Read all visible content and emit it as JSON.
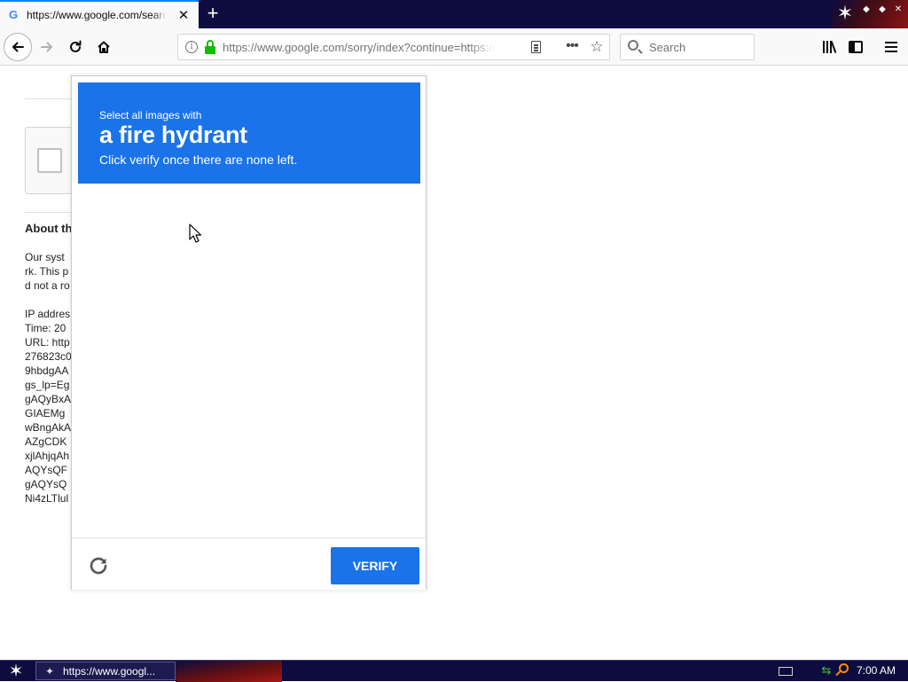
{
  "browser": {
    "tab": {
      "title": "https://www.google.com/search?q",
      "favicon": "G"
    },
    "nav": {
      "back_icon": "back-arrow-icon",
      "forward_icon": "forward-arrow-icon",
      "reload_icon": "reload-icon",
      "home_icon": "home-icon"
    },
    "urlbar": {
      "url": "https://www.google.com/sorry/index?continue=https://www"
    },
    "search": {
      "placeholder": "Search"
    }
  },
  "page": {
    "about_heading": "About th",
    "lines_group1": [
      "Our syst",
      "rk. This p",
      "d not a ro"
    ],
    "lines_group2": [
      "IP addres",
      "Time: 20",
      "URL: http",
      "276823c0",
      "9hbdgAA",
      "gs_lp=Eg",
      "gAQyBxA",
      "GIAEMg",
      "wBngAkA",
      "AZgCDK",
      "xjlAhjqAh",
      "AQYsQF",
      "gAQYsQ",
      "Ni4zLTlul"
    ]
  },
  "challenge": {
    "pre": "Select all images with",
    "target": "a fire hydrant",
    "post": "Click verify once there are none left.",
    "verify_label": "VERIFY",
    "accent": "#1a73e8"
  },
  "taskbar": {
    "task_label": "https://www.googl...",
    "clock": "7:00 AM"
  }
}
